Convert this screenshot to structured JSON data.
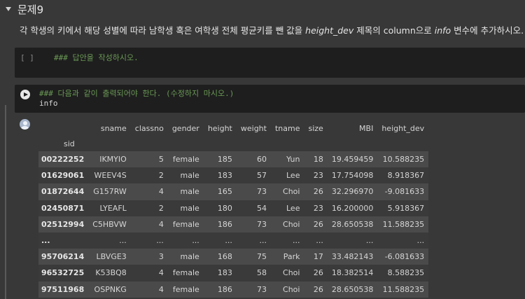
{
  "section": {
    "title": "문제9"
  },
  "description": {
    "part1": "각 학생의 키에서 해당 성별에 따라 남학생 혹은 여학생 전체 평균키를 뺀 값을 ",
    "var1": "height_dev",
    "part2": " 제목의 column으로 ",
    "var2": "info",
    "part3": " 변수에 추가하시오."
  },
  "cell1": {
    "bracket": "[ ]",
    "comment": "### 답안을 작성하시오."
  },
  "cell2": {
    "comment": "### 다음과 같이 출력되어야 한다. (수정하지 마시오.)",
    "code": "info"
  },
  "table": {
    "columns": [
      "sname",
      "classno",
      "gender",
      "height",
      "weight",
      "tname",
      "size",
      "MBI",
      "height_dev"
    ],
    "index_name": "sid",
    "rows": [
      {
        "sid": "00222252",
        "cells": [
          "IKMYIO",
          "5",
          "female",
          "185",
          "60",
          "Yun",
          "18",
          "19.459459",
          "10.588235"
        ]
      },
      {
        "sid": "01629061",
        "cells": [
          "WEEV4S",
          "2",
          "male",
          "183",
          "57",
          "Lee",
          "23",
          "17.754098",
          "8.918367"
        ]
      },
      {
        "sid": "01872644",
        "cells": [
          "G157RW",
          "4",
          "male",
          "165",
          "73",
          "Choi",
          "26",
          "32.296970",
          "-9.081633"
        ]
      },
      {
        "sid": "02450871",
        "cells": [
          "LYEAFL",
          "2",
          "male",
          "180",
          "54",
          "Lee",
          "23",
          "16.200000",
          "5.918367"
        ]
      },
      {
        "sid": "02512994",
        "cells": [
          "C5HBVW",
          "4",
          "female",
          "186",
          "73",
          "Choi",
          "26",
          "28.650538",
          "11.588235"
        ]
      },
      {
        "sid": "...",
        "cells": [
          "...",
          "...",
          "...",
          "...",
          "...",
          "...",
          "...",
          "...",
          "..."
        ]
      },
      {
        "sid": "95706214",
        "cells": [
          "LBVGE3",
          "3",
          "male",
          "168",
          "75",
          "Park",
          "17",
          "33.482143",
          "-6.081633"
        ]
      },
      {
        "sid": "96532725",
        "cells": [
          "K53BQ8",
          "4",
          "female",
          "183",
          "58",
          "Choi",
          "26",
          "18.382514",
          "8.588235"
        ]
      },
      {
        "sid": "97511968",
        "cells": [
          "OSPNKG",
          "4",
          "female",
          "186",
          "73",
          "Choi",
          "26",
          "28.650538",
          "11.588235"
        ]
      }
    ]
  }
}
